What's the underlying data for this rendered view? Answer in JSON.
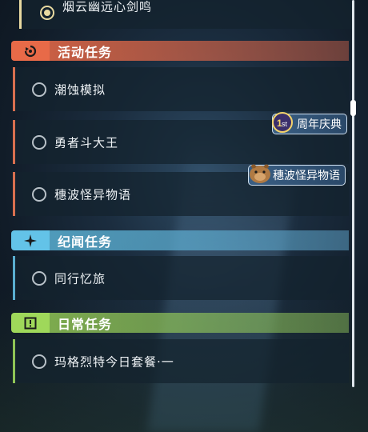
{
  "top_quest": {
    "label": "烟云幽远心剑鸣"
  },
  "sections": {
    "activity": {
      "title": "活动任务",
      "badge_icon": "swirl-icon",
      "color": "#e86a48",
      "quests": [
        {
          "label": "潮蚀模拟"
        },
        {
          "label": "勇者斗大王"
        },
        {
          "label": "穗波怪异物语"
        }
      ]
    },
    "chronicle": {
      "title": "纪闻任务",
      "badge_icon": "star-icon",
      "color": "#63c3e8",
      "quests": [
        {
          "label": "同行忆旅"
        }
      ]
    },
    "daily": {
      "title": "日常任务",
      "badge_icon": "exclamation-icon",
      "color": "#9fd85a",
      "quests": [
        {
          "label": "玛格烈特今日套餐·一"
        }
      ]
    }
  },
  "event_tags": [
    {
      "label": "周年庆典",
      "icon": "anniversary-1st-icon"
    },
    {
      "label": "穗波怪异物语",
      "icon": "capybara-mascot-icon"
    }
  ]
}
